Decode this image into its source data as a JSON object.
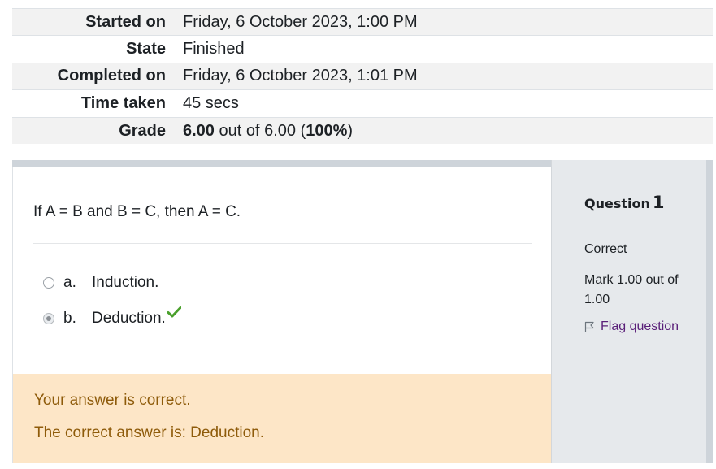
{
  "summary": {
    "rows": [
      {
        "label": "Started on",
        "value": "Friday, 6 October 2023, 1:00 PM"
      },
      {
        "label": "State",
        "value": "Finished"
      },
      {
        "label": "Completed on",
        "value": "Friday, 6 October 2023, 1:01 PM"
      },
      {
        "label": "Time taken",
        "value": "45 secs"
      }
    ],
    "grade": {
      "label": "Grade",
      "score": "6.00",
      "out_of_text": " out of 6.00 (",
      "percent": "100%",
      "close": ")"
    }
  },
  "question": {
    "info": {
      "label": "Question",
      "number": "1",
      "state": "Correct",
      "mark": "Mark 1.00 out of 1.00",
      "flag_label": "Flag question",
      "flag_icon": "flag-icon"
    },
    "text": "If A = B and B = C, then A = C.",
    "answers": [
      {
        "letter": "a.",
        "label": "Induction.",
        "selected": false
      },
      {
        "letter": "b.",
        "label": "Deduction.",
        "selected": true,
        "correct_icon": "check-icon"
      }
    ],
    "feedback": {
      "result": "Your answer is correct.",
      "correct_answer": "The correct answer is: Deduction."
    }
  },
  "colors": {
    "feedback_bg": "#fde6c7",
    "feedback_text": "#8e5b0a",
    "info_bg": "#e6e9ec",
    "check_green": "#4aa02c",
    "flag_link": "#5a1f79"
  }
}
